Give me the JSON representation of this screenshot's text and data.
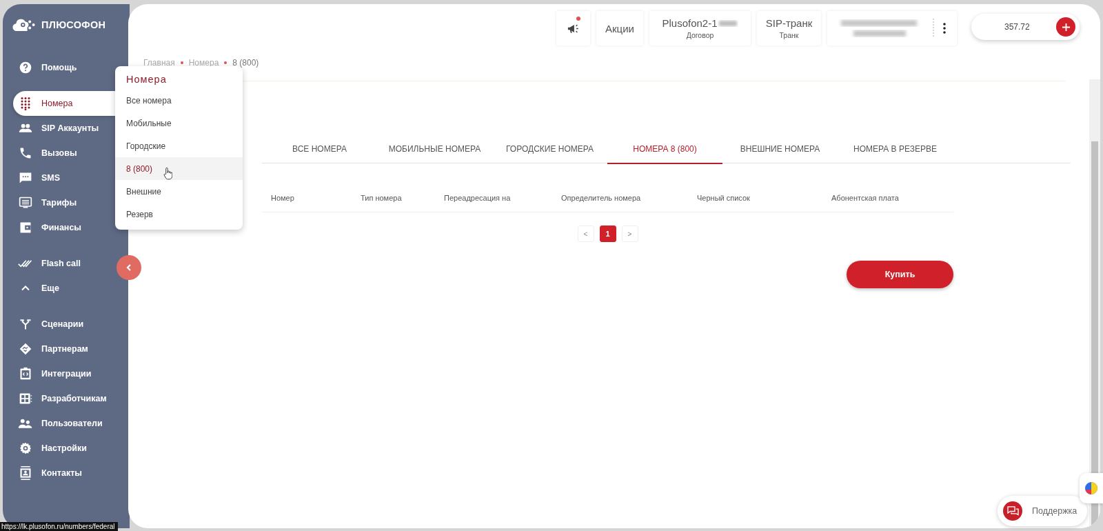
{
  "brand": {
    "name": "ПЛЮСОФОН"
  },
  "sidebar": {
    "groups": [
      {
        "items": [
          {
            "label": "Помощь",
            "selected": false
          }
        ]
      },
      {
        "items": [
          {
            "label": "Номера",
            "selected": true
          },
          {
            "label": "SIP Аккаунты",
            "selected": false
          },
          {
            "label": "Вызовы",
            "selected": false
          },
          {
            "label": "SMS",
            "selected": false
          },
          {
            "label": "Тарифы",
            "selected": false
          },
          {
            "label": "Финансы",
            "selected": false
          }
        ]
      },
      {
        "items": [
          {
            "label": "Flash call",
            "selected": false
          },
          {
            "label": "Еще",
            "selected": false
          }
        ]
      },
      {
        "items": [
          {
            "label": "Сценарии",
            "selected": false
          },
          {
            "label": "Партнерам",
            "selected": false
          },
          {
            "label": "Интеграции",
            "selected": false
          },
          {
            "label": "Разработчикам",
            "selected": false
          },
          {
            "label": "Пользователи",
            "selected": false
          },
          {
            "label": "Настройки",
            "selected": false
          },
          {
            "label": "Контакты",
            "selected": false
          }
        ]
      }
    ]
  },
  "submenu": {
    "title": "Номера",
    "items": [
      {
        "label": "Все номера",
        "selected": false
      },
      {
        "label": "Мобильные",
        "selected": false
      },
      {
        "label": "Городские",
        "selected": false
      },
      {
        "label": "8 (800)",
        "selected": true
      },
      {
        "label": "Внешние",
        "selected": false
      },
      {
        "label": "Резерв",
        "selected": false
      }
    ]
  },
  "header": {
    "notifications": {
      "unread": true
    },
    "promo": "Акции",
    "contract": {
      "value": "Plusofon2-1",
      "label": "Договор"
    },
    "trunk": {
      "value": "SIP-транк",
      "label": "Транк"
    },
    "balance": "357.72"
  },
  "breadcrumbs": [
    "Главная",
    "Номера",
    "8 (800)"
  ],
  "tabs": [
    {
      "label": "ВСЕ НОМЕРА",
      "selected": false
    },
    {
      "label": "МОБИЛЬНЫЕ НОМЕРА",
      "selected": false
    },
    {
      "label": "ГОРОДСКИЕ НОМЕРА",
      "selected": false
    },
    {
      "label": "НОМЕРА 8 (800)",
      "selected": true
    },
    {
      "label": "ВНЕШНИЕ НОМЕРА",
      "selected": false
    },
    {
      "label": "НОМЕРА В РЕЗЕРВЕ",
      "selected": false
    }
  ],
  "table": {
    "columns": [
      "Номер",
      "Тип номера",
      "Переадресация на",
      "Определитель номера",
      "Черный список",
      "Абонентская плата"
    ]
  },
  "pagination": {
    "prev": "<",
    "pages": [
      {
        "label": "1",
        "selected": true
      }
    ],
    "next": ">"
  },
  "buy_button": "Купить",
  "support_button": "Поддержка",
  "status_url": "https://lk.plusofon.ru/numbers/federal"
}
